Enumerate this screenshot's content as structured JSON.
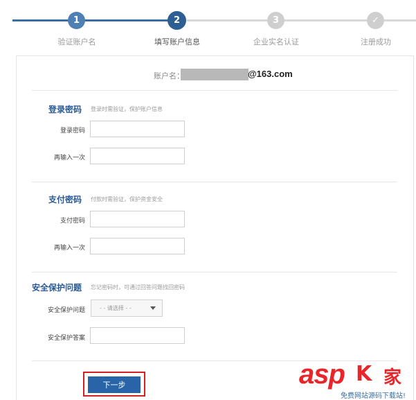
{
  "steps": [
    {
      "number": "1",
      "label": "验证账户名",
      "state": "done"
    },
    {
      "number": "2",
      "label": "填写账户信息",
      "state": "current"
    },
    {
      "number": "3",
      "label": "企业实名认证",
      "state": "todo"
    },
    {
      "number": "✓",
      "label": "注册成功",
      "state": "todo"
    }
  ],
  "account": {
    "label": "账户名：",
    "domain": "@163.com"
  },
  "login_password": {
    "title": "登录密码",
    "hint": "登录时需验证，保护账户信息",
    "password_label": "登录密码",
    "confirm_label": "再输入一次"
  },
  "pay_password": {
    "title": "支付密码",
    "hint": "付款时需验证，保护资金安全",
    "password_label": "支付密码",
    "confirm_label": "再输入一次"
  },
  "security": {
    "title": "安全保护问题",
    "hint": "忘记密码时，可通过回答问题找回密码",
    "question_label": "安全保护问题",
    "question_selected": "- - 请选择 - -",
    "answer_label": "安全保护答案"
  },
  "next_button": "下一步",
  "watermark": {
    "brand": "asp",
    "ku": "K",
    "jia": "家",
    "sub": "免费网站源码下载站!"
  },
  "colors": {
    "accent": "#2a64a8",
    "title": "#2a5a96",
    "highlight": "#d32020",
    "watermark": "#e8262a"
  }
}
